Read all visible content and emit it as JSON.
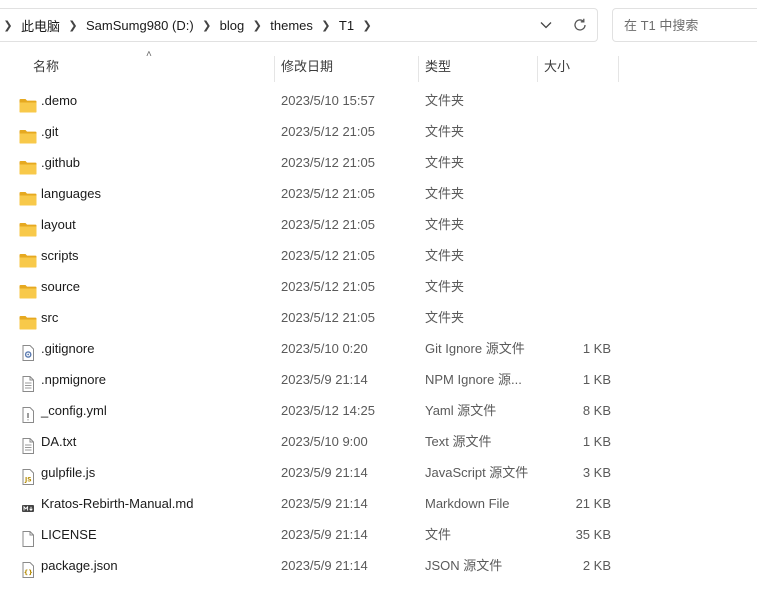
{
  "breadcrumb": [
    "此电脑",
    "SamSumg980 (D:)",
    "blog",
    "themes",
    "T1"
  ],
  "search": {
    "placeholder": "在 T1 中搜索"
  },
  "columns": {
    "name": "名称",
    "date": "修改日期",
    "type": "类型",
    "size": "大小"
  },
  "files": [
    {
      "name": ".demo",
      "date": "2023/5/10 15:57",
      "type": "文件夹",
      "size": "",
      "icon": "folder-icon"
    },
    {
      "name": ".git",
      "date": "2023/5/12 21:05",
      "type": "文件夹",
      "size": "",
      "icon": "folder-icon"
    },
    {
      "name": ".github",
      "date": "2023/5/12 21:05",
      "type": "文件夹",
      "size": "",
      "icon": "folder-icon"
    },
    {
      "name": "languages",
      "date": "2023/5/12 21:05",
      "type": "文件夹",
      "size": "",
      "icon": "folder-icon"
    },
    {
      "name": "layout",
      "date": "2023/5/12 21:05",
      "type": "文件夹",
      "size": "",
      "icon": "folder-icon"
    },
    {
      "name": "scripts",
      "date": "2023/5/12 21:05",
      "type": "文件夹",
      "size": "",
      "icon": "folder-icon"
    },
    {
      "name": "source",
      "date": "2023/5/12 21:05",
      "type": "文件夹",
      "size": "",
      "icon": "folder-icon"
    },
    {
      "name": "src",
      "date": "2023/5/12 21:05",
      "type": "文件夹",
      "size": "",
      "icon": "folder-icon"
    },
    {
      "name": ".gitignore",
      "date": "2023/5/10 0:20",
      "type": "Git Ignore 源文件",
      "size": "1 KB",
      "icon": "gear-file-icon"
    },
    {
      "name": ".npmignore",
      "date": "2023/5/9 21:14",
      "type": "NPM Ignore 源...",
      "size": "1 KB",
      "icon": "text-file-icon"
    },
    {
      "name": "_config.yml",
      "date": "2023/5/12 14:25",
      "type": "Yaml 源文件",
      "size": "8 KB",
      "icon": "yaml-file-icon"
    },
    {
      "name": "DA.txt",
      "date": "2023/5/10 9:00",
      "type": "Text 源文件",
      "size": "1 KB",
      "icon": "text-file-icon"
    },
    {
      "name": "gulpfile.js",
      "date": "2023/5/9 21:14",
      "type": "JavaScript 源文件",
      "size": "3 KB",
      "icon": "js-file-icon"
    },
    {
      "name": "Kratos-Rebirth-Manual.md",
      "date": "2023/5/9 21:14",
      "type": "Markdown File",
      "size": "21 KB",
      "icon": "markdown-file-icon"
    },
    {
      "name": "LICENSE",
      "date": "2023/5/9 21:14",
      "type": "文件",
      "size": "35 KB",
      "icon": "blank-file-icon"
    },
    {
      "name": "package.json",
      "date": "2023/5/9 21:14",
      "type": "JSON 源文件",
      "size": "2 KB",
      "icon": "json-file-icon"
    }
  ],
  "colors": {
    "folder": "#f8c94a",
    "folder_dark": "#e6a920",
    "border": "#e1e1e1"
  }
}
